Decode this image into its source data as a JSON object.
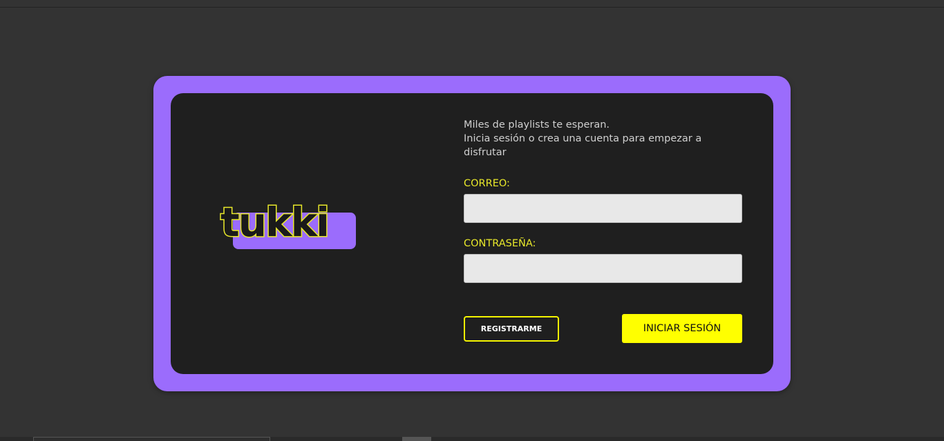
{
  "logo": {
    "wordmark": "tukki",
    "colors": {
      "text": "#1a1a1a",
      "outline": "#e8e82a",
      "accent_block": "#9b6cfc"
    }
  },
  "intro": {
    "line1": "Miles de playlists te esperan.",
    "line2": "Inicia sesión o crea una cuenta para empezar a disfrutar"
  },
  "form": {
    "email_label": "CORREO:",
    "email_value": "",
    "password_label": "CONTRASEÑA:",
    "password_value": ""
  },
  "buttons": {
    "register_label": "REGISTRARME",
    "login_label": "INICIAR SESIÓN"
  },
  "colors": {
    "background": "#333333",
    "card_frame": "#9b6cfc",
    "card_body": "#1f1f1f",
    "accent_yellow": "#ffff00",
    "label_yellow": "#e8e82a"
  }
}
